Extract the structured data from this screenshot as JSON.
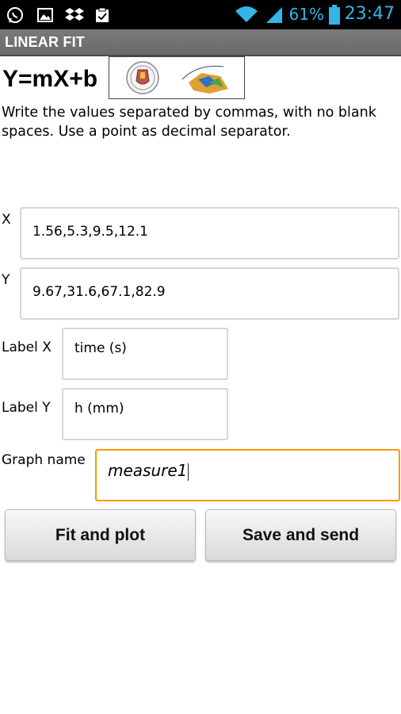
{
  "status_bar": {
    "icons": [
      "whatsapp-icon",
      "image-icon",
      "dropbox-icon",
      "clipboard-check-icon",
      "wifi-icon",
      "signal-icon",
      "battery-icon"
    ],
    "battery": "61%",
    "time": "23:47",
    "accent_color": "#33b5e5"
  },
  "title_bar": {
    "title": "LINEAR FIT"
  },
  "header": {
    "formula": "Y=mX+b",
    "logos": [
      "university-seal-logo",
      "map-graph-logo"
    ]
  },
  "instructions": "Write the values separated by commas, with no blank spaces. Use a point as decimal separator.",
  "form": {
    "x": {
      "label": "X",
      "value": "1.56,5.3,9.5,12.1"
    },
    "y": {
      "label": "Y",
      "value": "9.67,31.6,67.1,82.9"
    },
    "label_x": {
      "label": "Label X",
      "value": "time (s)"
    },
    "label_y": {
      "label": "Label Y",
      "value": "h (mm)"
    },
    "graph_name": {
      "label": "Graph name",
      "value": "measure1",
      "focus_color": "#ff9900"
    }
  },
  "buttons": {
    "fit_plot": "Fit and plot",
    "save_send": "Save and send"
  }
}
